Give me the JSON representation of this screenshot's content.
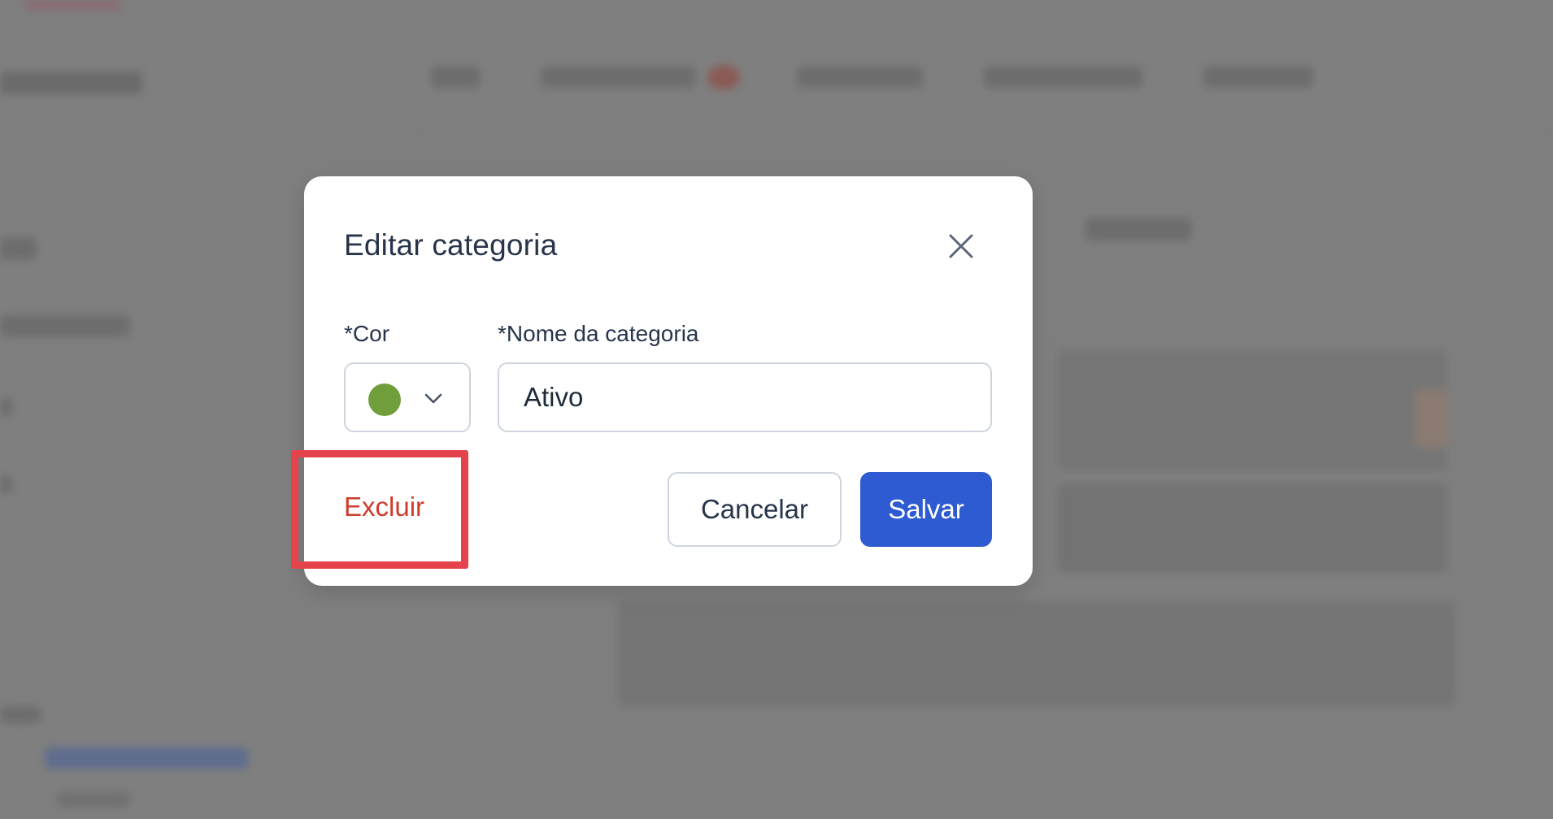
{
  "modal": {
    "title": "Editar categoria",
    "close_icon": "close-icon",
    "color_field": {
      "required_mark": "*",
      "label": "Cor",
      "selected_color": "#6f9e3a",
      "dropdown_icon": "chevron-down-icon"
    },
    "name_field": {
      "required_mark": "*",
      "label": "Nome da categoria",
      "value": "Ativo"
    },
    "delete_label": "Excluir",
    "cancel_label": "Cancelar",
    "save_label": "Salvar"
  },
  "colors": {
    "overlay": "#7f7f7f",
    "primary": "#2e5bd1",
    "danger": "#cf3b2c",
    "highlight": "#e5434b"
  }
}
